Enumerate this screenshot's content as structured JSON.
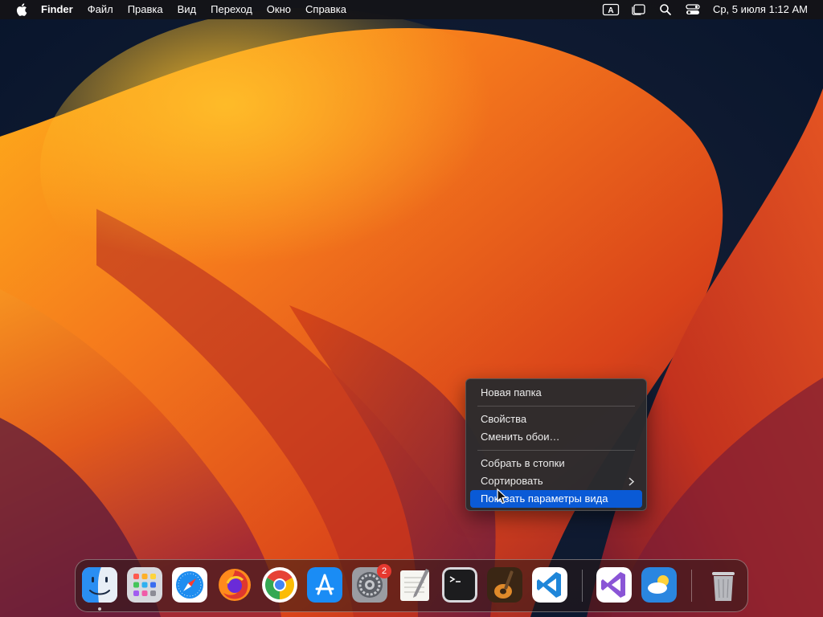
{
  "menubar": {
    "app_name": "Finder",
    "menus": [
      "Файл",
      "Правка",
      "Вид",
      "Переход",
      "Окно",
      "Справка"
    ],
    "input_source": "A",
    "clock": "Ср, 5 июля  1:12 AM"
  },
  "context_menu": {
    "items": [
      {
        "label": "Новая папка"
      },
      {
        "label": "Свойства"
      },
      {
        "label": "Сменить обои…"
      },
      {
        "label": "Собрать в стопки"
      },
      {
        "label": "Сортировать",
        "submenu": true
      },
      {
        "label": "Показать параметры вида",
        "highlighted": true
      }
    ]
  },
  "dock": {
    "apps": [
      {
        "name": "Finder",
        "icon": "finder-icon",
        "running": true
      },
      {
        "name": "Launchpad",
        "icon": "launchpad-icon"
      },
      {
        "name": "Safari",
        "icon": "safari-icon"
      },
      {
        "name": "Firefox",
        "icon": "firefox-icon"
      },
      {
        "name": "Chrome",
        "icon": "chrome-icon"
      },
      {
        "name": "App Store",
        "icon": "app-store-icon"
      },
      {
        "name": "System Settings",
        "icon": "system-settings-icon",
        "badge": "2"
      },
      {
        "name": "TextEdit",
        "icon": "textedit-icon"
      },
      {
        "name": "Terminal",
        "icon": "terminal-icon"
      },
      {
        "name": "GarageBand",
        "icon": "garageband-icon"
      },
      {
        "name": "Visual Studio Code",
        "icon": "vscode-icon"
      },
      {
        "name": "Visual Studio",
        "icon": "visual-studio-icon"
      },
      {
        "name": "Weather",
        "icon": "weather-icon"
      },
      {
        "name": "Trash",
        "icon": "trash-icon"
      }
    ]
  },
  "colors": {
    "menu_highlight": "#0a5ad6",
    "badge": "#e6382f",
    "wallpaper_primary": "#f26a1b",
    "wallpaper_background": "#0b1a33"
  }
}
